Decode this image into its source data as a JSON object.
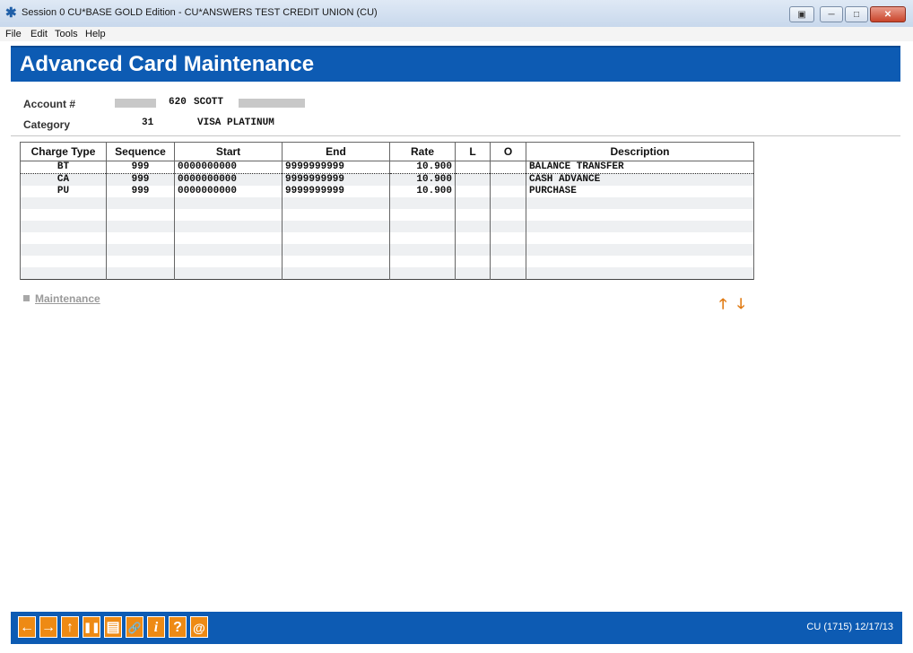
{
  "window": {
    "title": "Session 0 CU*BASE GOLD Edition - CU*ANSWERS TEST CREDIT UNION (CU)",
    "controls": {
      "restore": "▣",
      "minimize": "─",
      "maximize": "□",
      "close": "✕"
    }
  },
  "menu": {
    "items": [
      "File",
      "Edit",
      "Tools",
      "Help"
    ]
  },
  "page": {
    "title": "Advanced Card Maintenance"
  },
  "account": {
    "label": "Account #",
    "number": "620",
    "name": "SCOTT"
  },
  "category": {
    "label": "Category",
    "code": "31",
    "name": "VISA PLATINUM"
  },
  "table": {
    "headers": [
      "Charge Type",
      "Sequence",
      "Start",
      "End",
      "Rate",
      "L",
      "O",
      "Description"
    ],
    "rows": [
      {
        "charge_type": "BT",
        "sequence": "999",
        "start": "0000000000",
        "end": "9999999999",
        "rate": "10.900",
        "l": "",
        "o": "",
        "description": "BALANCE TRANSFER"
      },
      {
        "charge_type": "CA",
        "sequence": "999",
        "start": "0000000000",
        "end": "9999999999",
        "rate": "10.900",
        "l": "",
        "o": "",
        "description": "CASH ADVANCE"
      },
      {
        "charge_type": "PU",
        "sequence": "999",
        "start": "0000000000",
        "end": "9999999999",
        "rate": "10.900",
        "l": "",
        "o": "",
        "description": "PURCHASE"
      }
    ],
    "empty_rows": 7
  },
  "actions": {
    "maintenance": "Maintenance"
  },
  "footer": {
    "buttons": [
      {
        "name": "back-button",
        "icon": "←"
      },
      {
        "name": "forward-button",
        "icon": "→"
      },
      {
        "name": "up-button",
        "icon": "↑"
      },
      {
        "name": "pause-button",
        "icon": "❚❚"
      },
      {
        "name": "print-button",
        "icon": "▤"
      },
      {
        "name": "link-button",
        "icon": "🔗"
      },
      {
        "name": "info-button",
        "icon": "i"
      },
      {
        "name": "help-button",
        "icon": "?"
      },
      {
        "name": "email-button",
        "icon": "@"
      }
    ],
    "status": "CU (1715) 12/17/13"
  },
  "colors": {
    "brand_blue": "#0d5bb3",
    "accent_orange": "#ee8a14"
  }
}
